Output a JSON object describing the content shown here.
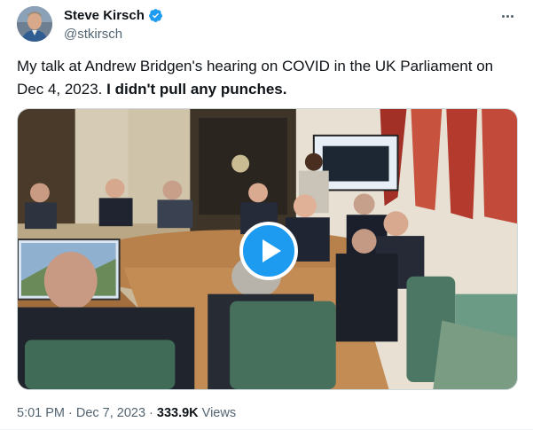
{
  "author": {
    "display_name": "Steve Kirsch",
    "handle": "@stkirsch",
    "verified": true,
    "verified_color": "#1d9bf0"
  },
  "tweet": {
    "text_plain": "My talk at Andrew Bridgen's hearing on COVID in the UK Parliament on Dec 4, 2023.",
    "text_bold": "I didn't pull any punches."
  },
  "media": {
    "type": "video",
    "play_icon": "play-icon"
  },
  "meta": {
    "time": "5:01 PM",
    "separator": "·",
    "date": "Dec 7, 2023",
    "views_count": "333.9K",
    "views_label": "Views"
  },
  "icons": {
    "more": "more-options-icon",
    "verified": "verified-badge-icon"
  },
  "colors": {
    "accent": "#1d9bf0",
    "secondary_text": "#536471",
    "primary_text": "#0f1419"
  }
}
